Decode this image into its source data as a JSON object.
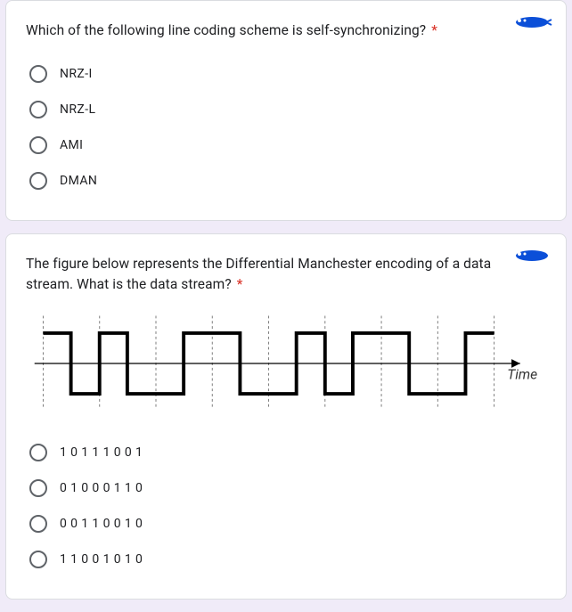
{
  "questions": [
    {
      "text": "Which of the following line coding scheme is self-synchronizing?",
      "required_marker": "*",
      "options": [
        "NRZ-I",
        "NRZ-L",
        "AMI",
        "DMAN"
      ]
    },
    {
      "text": "The figure below represents the Differential Manchester encoding of a data stream. What is the data stream?",
      "required_marker": "*",
      "time_label": "Time",
      "options": [
        "1 0 1 1 1 0 0 1",
        "0 1 0 0 0 1 1 0",
        "0 0 1 1 0 0 1 0",
        "1 1 0 0 1 0 1 0"
      ]
    }
  ]
}
